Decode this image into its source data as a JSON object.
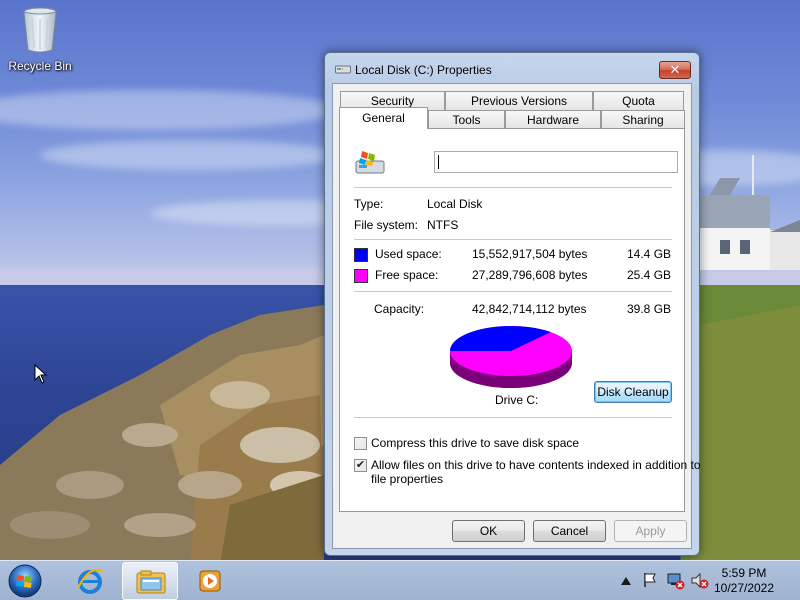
{
  "desktop": {
    "icons": [
      {
        "label": "Recycle Bin",
        "icon": "recycle-bin-icon"
      }
    ]
  },
  "window": {
    "title": "Local Disk (C:) Properties",
    "close_label": "✕",
    "tabs_row1": [
      "Security",
      "Previous Versions",
      "Quota"
    ],
    "tabs_row2": [
      "General",
      "Tools",
      "Hardware",
      "Sharing"
    ],
    "active_tab": "General",
    "general": {
      "name_value": "",
      "type_label": "Type:",
      "type_value": "Local Disk",
      "fs_label": "File system:",
      "fs_value": "NTFS",
      "used": {
        "label": "Used space:",
        "bytes": "15,552,917,504 bytes",
        "size": "14.4 GB",
        "color": "#0000ff"
      },
      "free": {
        "label": "Free space:",
        "bytes": "27,289,796,608 bytes",
        "size": "25.4 GB",
        "color": "#ff00ff"
      },
      "capacity": {
        "label": "Capacity:",
        "bytes": "42,842,714,112 bytes",
        "size": "39.8 GB"
      },
      "drive_label": "Drive C:",
      "used_fraction": 0.363,
      "disk_cleanup_label": "Disk Cleanup",
      "compress_label": "Compress this drive to save disk space",
      "compress_checked": false,
      "index_label_line1": "Allow files on this drive to have contents indexed in addition to",
      "index_label_line2": "file properties",
      "index_checked": true
    },
    "buttons": {
      "ok": "OK",
      "cancel": "Cancel",
      "apply": "Apply"
    }
  },
  "taskbar": {
    "pinned": [
      "start-orb-icon",
      "internet-explorer-icon",
      "windows-explorer-icon",
      "media-player-icon"
    ],
    "tray": [
      "show-hidden-icons-icon",
      "action-center-flag-icon",
      "network-icon",
      "volume-muted-icon"
    ],
    "clock_time": "5:59 PM",
    "clock_date": "10/27/2022"
  }
}
